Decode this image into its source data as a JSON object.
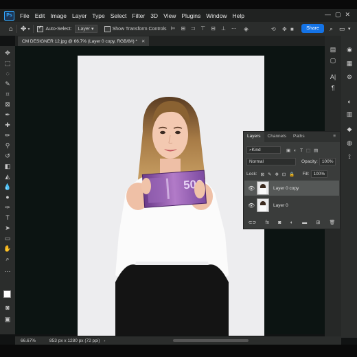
{
  "menu": {
    "app_logo": "Ps",
    "items": [
      "File",
      "Edit",
      "Image",
      "Layer",
      "Type",
      "Select",
      "Filter",
      "3D",
      "View",
      "Plugins",
      "Window",
      "Help"
    ]
  },
  "options": {
    "auto_select_label": "Auto-Select:",
    "auto_select_value": "Layer",
    "show_transform_label": "Show Transform Controls",
    "share_label": "Share"
  },
  "document": {
    "tab_title": "CM DESIGNER 12.jpg @ 66.7% (Layer 0 copy, RGB/8#) *"
  },
  "status": {
    "zoom": "66.67%",
    "size": "853 px x 1280 px (72 ppi)"
  },
  "layers_panel": {
    "tabs": [
      "Layers",
      "Channels",
      "Paths"
    ],
    "filter_kind": "Kind",
    "blend_mode": "Normal",
    "opacity_label": "Opacity:",
    "opacity_value": "100%",
    "lock_label": "Lock:",
    "fill_label": "Fill:",
    "fill_value": "100%",
    "layers": [
      {
        "name": "Layer 0 copy",
        "selected": true
      },
      {
        "name": "Layer 0",
        "selected": false
      }
    ]
  },
  "canvas": {
    "banknote_value": "500"
  },
  "colors": {
    "accent": "#1473e6",
    "app_bg": "#2b2d2c"
  }
}
